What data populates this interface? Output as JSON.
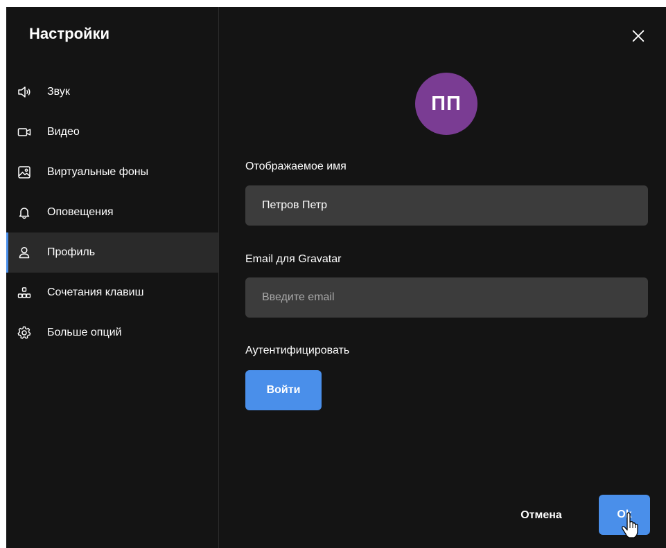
{
  "sidebar": {
    "title": "Настройки",
    "items": [
      {
        "label": "Звук",
        "icon": "speaker-icon",
        "active": false
      },
      {
        "label": "Видео",
        "icon": "video-camera-icon",
        "active": false
      },
      {
        "label": "Виртуальные фоны",
        "icon": "image-icon",
        "active": false
      },
      {
        "label": "Оповещения",
        "icon": "bell-icon",
        "active": false
      },
      {
        "label": "Профиль",
        "icon": "user-icon",
        "active": true
      },
      {
        "label": "Сочетания клавиш",
        "icon": "shortcuts-icon",
        "active": false
      },
      {
        "label": "Больше опций",
        "icon": "gear-icon",
        "active": false
      }
    ]
  },
  "profile": {
    "avatar_initials": "ПП",
    "avatar_color": "#7a3c93",
    "display_name_label": "Отображаемое имя",
    "display_name_value": "Петров Петр",
    "email_label": "Email для Gravatar",
    "email_value": "",
    "email_placeholder": "Введите email",
    "auth_label": "Аутентифицировать",
    "login_button": "Войти"
  },
  "footer": {
    "cancel_label": "Отмена",
    "ok_label": "Ok"
  },
  "colors": {
    "accent": "#4a8fea",
    "background": "#141414",
    "input_background": "#3c3c3c",
    "active_item_background": "#2a2a2a"
  },
  "close_icon": "close-icon"
}
